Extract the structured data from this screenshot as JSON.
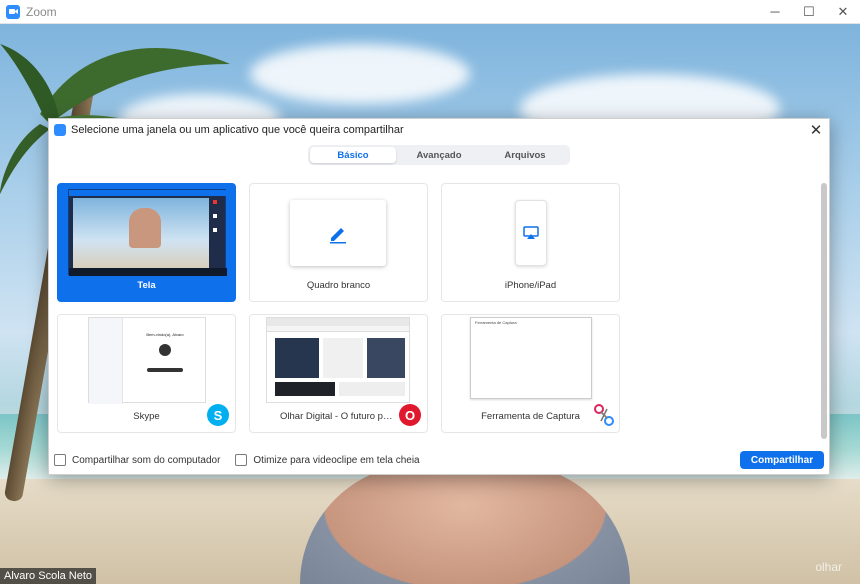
{
  "window": {
    "title": "Zoom",
    "controls": {
      "minimize": "─",
      "maximize": "☐",
      "close": "✕"
    }
  },
  "video": {
    "participant_name": "Alvaro Scola Neto",
    "watermark": "olhar"
  },
  "dialog": {
    "title": "Selecione uma janela ou um aplicativo que você queira compartilhar",
    "close": "✕",
    "tabs": [
      "Básico",
      "Avançado",
      "Arquivos"
    ],
    "active_tab": "Básico",
    "tiles": [
      {
        "label": "Tela",
        "selected": true
      },
      {
        "label": "Quadro branco"
      },
      {
        "label": "iPhone/iPad"
      },
      {
        "label": "Skype",
        "thumb_text": "Bem-vindo(a), Alvaro",
        "badge": "S"
      },
      {
        "label": "Olhar Digital - O futuro passa pri...",
        "badge": "O"
      },
      {
        "label": "Ferramenta de Captura",
        "thumb_text": "Ferramenta de Captura"
      }
    ],
    "options": {
      "share_sound": "Compartilhar som do computador",
      "optimize_video": "Otimize para videoclipe em tela cheia"
    },
    "share_button": "Compartilhar"
  },
  "colors": {
    "accent": "#0e71eb",
    "zoom_blue": "#2d8cff"
  }
}
